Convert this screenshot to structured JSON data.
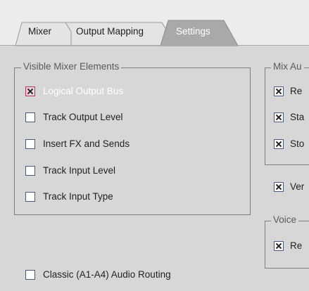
{
  "tabs": [
    {
      "label": "Mixer",
      "active": false
    },
    {
      "label": "Output Mapping",
      "active": false
    },
    {
      "label": "Settings",
      "active": true
    }
  ],
  "visible_mixer_elements": {
    "legend": "Visible Mixer Elements",
    "items": [
      {
        "label": "Logical Output Bus",
        "checked": true
      },
      {
        "label": "Track Output Level",
        "checked": false
      },
      {
        "label": "Insert FX and Sends",
        "checked": false
      },
      {
        "label": "Track Input Level",
        "checked": false
      },
      {
        "label": "Track Input Type",
        "checked": false
      }
    ]
  },
  "mix_audio": {
    "legend": "Mix Au",
    "items": [
      {
        "label": "Re",
        "checked": true
      },
      {
        "label": "Sta",
        "checked": true
      },
      {
        "label": "Sto",
        "checked": true
      }
    ]
  },
  "standalone_option": {
    "label": "Ver",
    "checked": true
  },
  "voice_group": {
    "legend": "Voice",
    "items": [
      {
        "label": "Re",
        "checked": true
      }
    ]
  },
  "classic_routing": {
    "label": "Classic (A1-A4) Audio Routing",
    "checked": false
  }
}
